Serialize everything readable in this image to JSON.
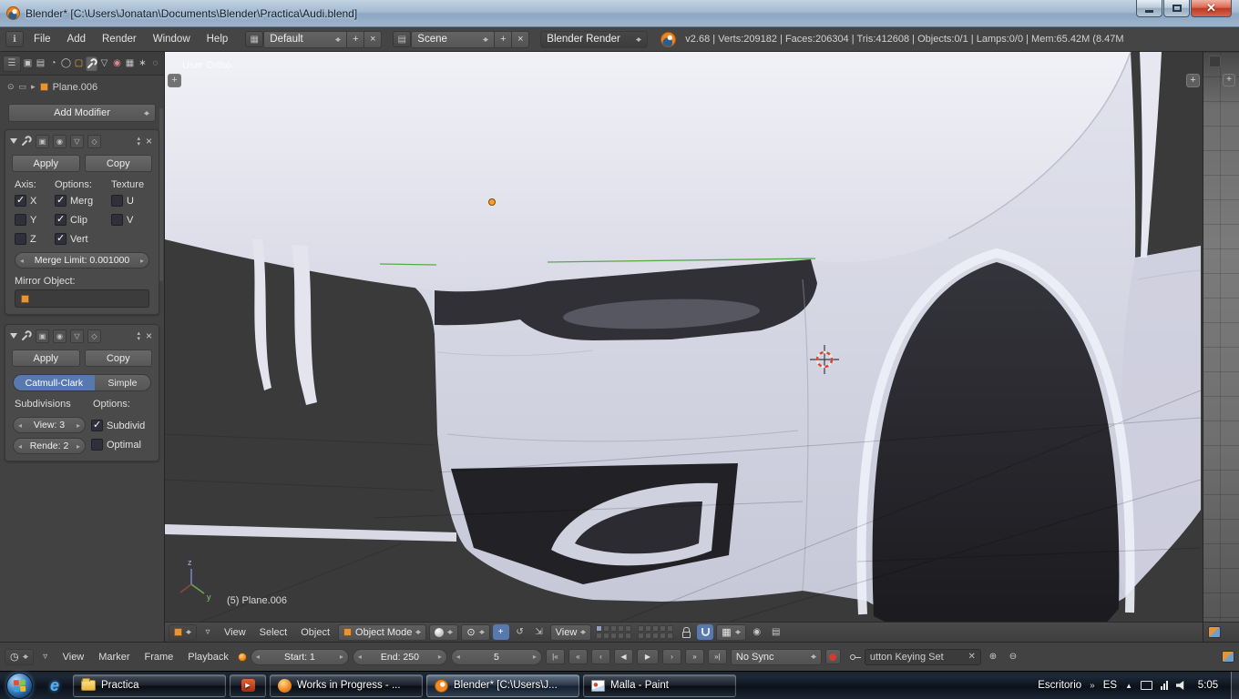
{
  "colors": {
    "accent-blue": "#5878b0",
    "brand-orange": "#f0831c",
    "viewport-bg": "#3a3a3a",
    "header-bg": "#454545",
    "axis-green": "#5aa84b",
    "cursor-red": "#d6453a"
  },
  "titlebar": {
    "title": "Blender* [C:\\Users\\Jonatan\\Documents\\Blender\\Practica\\Audi.blend]"
  },
  "infobar": {
    "menus": [
      "File",
      "Add",
      "Render",
      "Window",
      "Help"
    ],
    "layout": "Default",
    "scene": "Scene",
    "engine": "Blender Render",
    "stats": "v2.68 | Verts:209182 | Faces:206304 | Tris:412608 | Objects:0/1 | Lamps:0/0 | Mem:65.42M (8.47M"
  },
  "properties": {
    "breadcrumb_object": "Plane.006",
    "add_modifier_label": "Add Modifier",
    "mirror": {
      "apply_label": "Apply",
      "copy_label": "Copy",
      "axis_label": "Axis:",
      "options_label": "Options:",
      "texture_label": "Texture",
      "checks": {
        "x": {
          "label": "X",
          "checked": true
        },
        "y": {
          "label": "Y",
          "checked": false
        },
        "z": {
          "label": "Z",
          "checked": false
        },
        "merge": {
          "label": "Merg",
          "checked": true
        },
        "clip": {
          "label": "Clip",
          "checked": true
        },
        "vert": {
          "label": "Vert",
          "checked": true
        },
        "u": {
          "label": "U",
          "checked": false
        },
        "v": {
          "label": "V",
          "checked": false
        }
      },
      "merge_limit": "Merge Limit: 0.001000",
      "mirror_object_label": "Mirror Object:"
    },
    "subsurf": {
      "apply_label": "Apply",
      "copy_label": "Copy",
      "catmull_label": "Catmull-Clark",
      "simple_label": "Simple",
      "subdivisions_label": "Subdivisions",
      "options_label": "Options:",
      "view_field": "View: 3",
      "render_field": "Rende: 2",
      "subdivide": {
        "label": "Subdivid",
        "checked": true
      },
      "optimal": {
        "label": "Optimal",
        "checked": false
      }
    }
  },
  "viewport": {
    "overlay_view_label": "User Ortho",
    "overlay_object_label": "(5) Plane.006",
    "gizmo": {
      "z": "z",
      "y": "y"
    },
    "header": {
      "menus": [
        "View",
        "Select",
        "Object"
      ],
      "mode": "Object Mode",
      "orientation": "View"
    }
  },
  "timeline": {
    "menus": [
      "View",
      "Marker",
      "Frame",
      "Playback"
    ],
    "start_field": "Start: 1",
    "end_field": "End: 250",
    "current_frame": "5",
    "sync": "No Sync",
    "keying_set": "utton Keying Set"
  },
  "taskbar": {
    "items": [
      "Practica",
      "",
      "Works in Progress - ...",
      "Blender* [C:\\Users\\J...",
      "Malla - Paint"
    ],
    "tray": {
      "desktop_label": "Escritorio",
      "language": "ES",
      "time": "5:05"
    }
  }
}
